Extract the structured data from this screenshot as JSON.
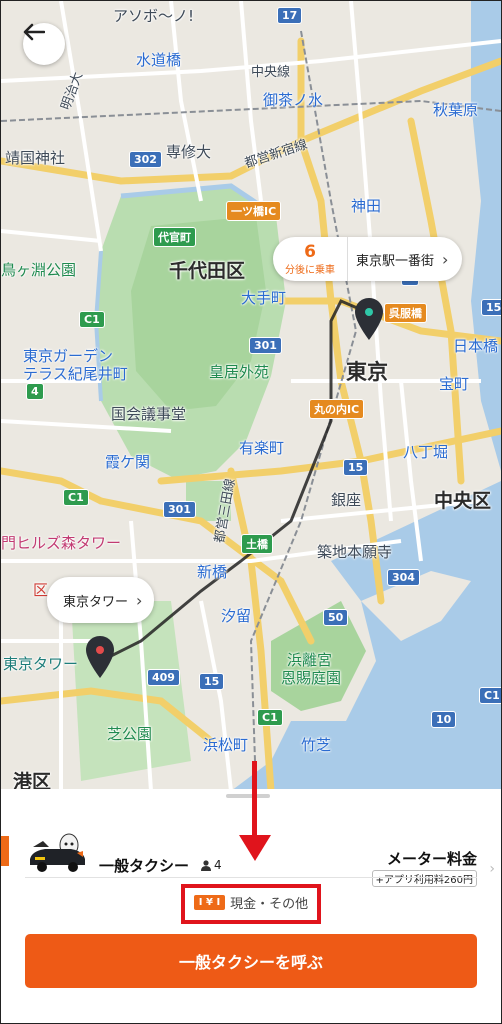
{
  "map": {
    "labels": {
      "asobono": "アソボ〜ノ!",
      "suidobashi": "水道橋",
      "chuo_line": "中央線",
      "ochanomizu": "御茶ノ水",
      "akihabara": "秋葉原",
      "meiji": "明治大",
      "shuto_exp": "都営新宿線",
      "senshu": "専修大",
      "yasukuni": "靖国神社",
      "hitotsubashi": "一ツ橋IC",
      "kanda": "神田",
      "daikanzan": "代官町",
      "chiyoda": "千代田区",
      "chidorigafuchi": "鳥ヶ淵公園",
      "otemachi": "大手町",
      "gofukubashi": "呉服橋",
      "tokyo_garden": "東京ガーデン",
      "terrace": "テラス紀尾井町",
      "kokyo_gaien": "皇居外苑",
      "tokyo": "東京",
      "nihonbashi": "日本橋",
      "marunouchi_ic": "丸の内IC",
      "takaracho": "宝町",
      "kokkai": "国会議事堂",
      "yurakucho": "有楽町",
      "hatchobori": "八丁堀",
      "kasumigaseki": "霞ケ関",
      "toei_mita": "都営三田線",
      "chuo": "中央区",
      "ginza": "銀座",
      "toranomon": "門ヒルズ森タワー",
      "dobashi": "土橋",
      "tsukiji": "築地本願寺",
      "shinbashi": "新橋",
      "shiodome": "汐留",
      "tokyo_tower_label": "東京タワー",
      "hamarikyu1": "浜離宮",
      "hamarikyu2": "恩賜庭園",
      "shibakoen": "芝公園",
      "hamamatsucho": "浜松町",
      "takeshiba": "竹芝",
      "minato": "港区",
      "ku_suffix": "区"
    },
    "route_shields": [
      "302",
      "17",
      "301",
      "301",
      "15",
      "C1",
      "C1",
      "4",
      "C1",
      "409",
      "15",
      "304",
      "50",
      "10",
      "C1",
      "15",
      "4"
    ]
  },
  "top_bar": {
    "back_icon": "arrow-left-icon"
  },
  "pickup_bubble": {
    "eta_minutes": "6",
    "eta_caption": "分後に乗車",
    "address": "東京駅一番街",
    "chevron": "›"
  },
  "destination_bubble": {
    "address": "東京タワー",
    "chevron": "›"
  },
  "sheet": {
    "service_name": "一般タクシー",
    "seats": "4",
    "fare_title": "メーター料金",
    "fare_note": "+アプリ利用料260円",
    "payment_chip": "I ¥ I",
    "payment_text": "現金・その他",
    "cta_label": "一般タクシーを呼ぶ"
  },
  "colors": {
    "accent_orange": "#ee5a16",
    "annotation_red": "#e0141c",
    "park_green": "#b7dcae",
    "water_blue": "#a9cbe8",
    "road_yellow": "#f5d26b"
  }
}
